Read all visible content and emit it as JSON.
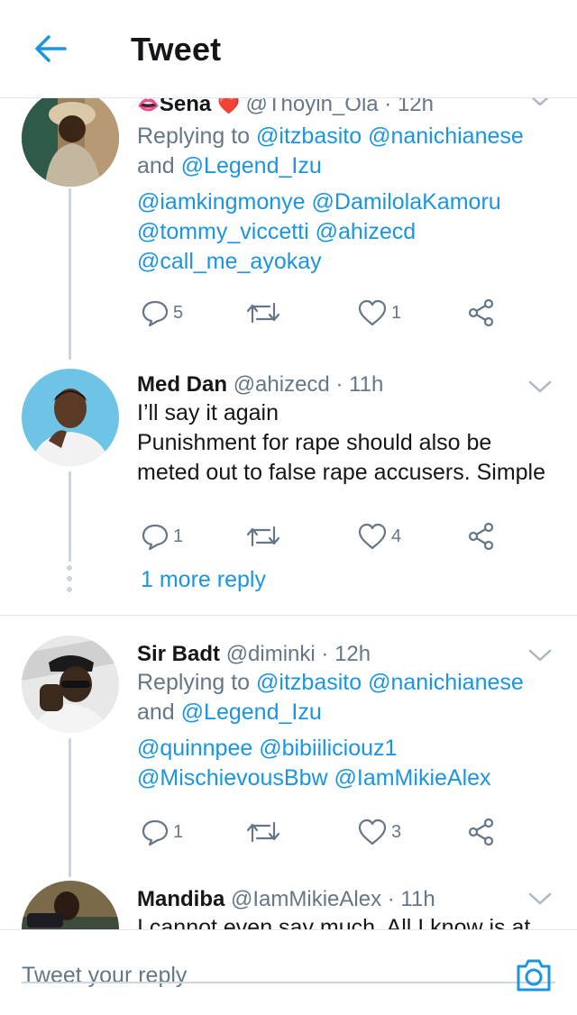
{
  "header": {
    "title": "Tweet"
  },
  "tweets": [
    {
      "name": "Sena",
      "name_prefix_emoji": "👄",
      "name_suffix_emoji": "❤️",
      "handle": "@Thoyin_Ola",
      "time": "· 12h",
      "replying_label": "Replying to",
      "replying_to": "@itzbasito @nanichianese",
      "replying_and": "and",
      "replying_last": "@Legend_Izu",
      "body_line1": "@iamkingmonye @DamilolaKamoru",
      "body_line2": "@tommy_viccetti @ahizecd",
      "body_line3": "@call_me_ayokay",
      "replies": "5",
      "retweets": "",
      "likes": "1"
    },
    {
      "name": "Med Dan",
      "handle": "@ahizecd",
      "time": "· 11h",
      "body_line1": "I’ll say it again",
      "body_line2": "Punishment for rape should also be",
      "body_line3": "meted out to false rape accusers. Simple",
      "replies": "1",
      "retweets": "",
      "likes": "4",
      "more_reply": "1 more reply"
    },
    {
      "name": "Sir Badt",
      "handle": "@diminki",
      "time": "· 12h",
      "replying_label": "Replying to",
      "replying_to": "@itzbasito @nanichianese",
      "replying_and": "and",
      "replying_last": "@Legend_Izu",
      "body_line1": "@quinnpee @bibiiliciouz1",
      "body_line2": "@MischievousBbw @IamMikieAlex",
      "replies": "1",
      "retweets": "",
      "likes": "3"
    },
    {
      "name": "Mandiba",
      "handle": "@IamMikieAlex",
      "time": "· 11h",
      "body_line1": "I cannot even say much. All I know is at"
    }
  ],
  "compose": {
    "placeholder": "Tweet your reply"
  },
  "colors": {
    "accent": "#1b95e0",
    "muted": "#657786",
    "divider": "#e1e8ed",
    "heart_emoji": "#e0245e"
  }
}
